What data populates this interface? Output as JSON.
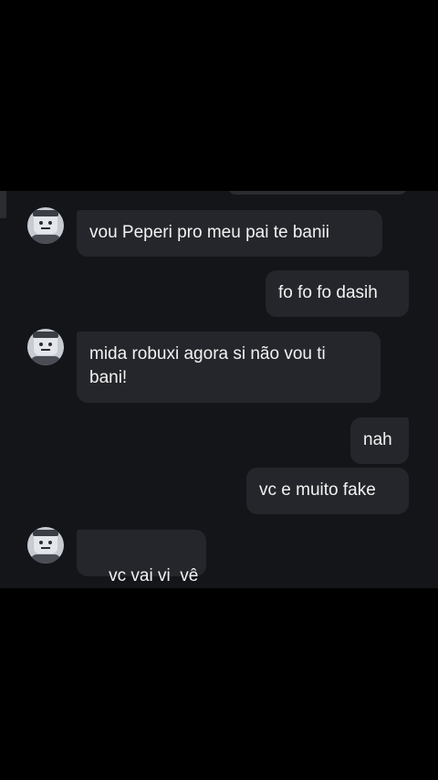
{
  "messages": [
    {
      "from": "other",
      "text": "vou Peperi pro meu pai te banii"
    },
    {
      "from": "me",
      "text": "fo fo fo dasih"
    },
    {
      "from": "other",
      "text": "mida robuxi agora si não vou ti bani!"
    },
    {
      "from": "me",
      "text": "nah"
    },
    {
      "from": "me",
      "text": "vc e muito fake"
    },
    {
      "from": "other",
      "text": "vc vai vi  vê"
    }
  ],
  "avatar": {
    "icon": "roblox-avatar-icon"
  },
  "colors": {
    "page_bg": "#000000",
    "chat_bg": "#141519",
    "bubble_bg": "#25262b",
    "text": "#f2f2f2"
  }
}
